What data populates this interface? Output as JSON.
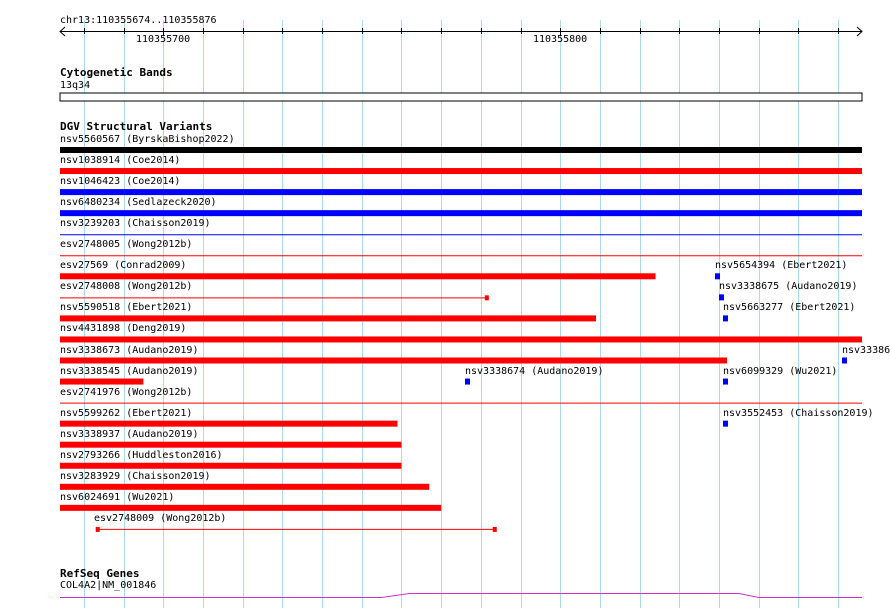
{
  "colors": {
    "grid": "#aadbee",
    "red": "#ff0000",
    "blue": "#0000ff",
    "black": "#000000",
    "refseq": "#cc33cc",
    "separator": "#cc0000"
  },
  "ruler": {
    "locus": "chr13:110355674..110355876",
    "ticks": [
      {
        "pos": 110355700,
        "label": "110355700"
      },
      {
        "pos": 110355800,
        "label": "110355800"
      }
    ]
  },
  "cytobands": {
    "title": "Cytogenetic Bands",
    "band": "13q34"
  },
  "dgv": {
    "title": "DGV Structural Variants",
    "rows": [
      {
        "label": "nsv5560567 (ByrskaBishop2022)",
        "features": [
          {
            "start": 110355674,
            "end": 110355876,
            "color": "black",
            "style": "bar"
          }
        ]
      },
      {
        "label": "nsv1038914 (Coe2014)",
        "features": [
          {
            "start": 110355674,
            "end": 110355876,
            "color": "red",
            "style": "bar"
          }
        ]
      },
      {
        "label": "nsv1046423 (Coe2014)",
        "features": [
          {
            "start": 110355674,
            "end": 110355876,
            "color": "blue",
            "style": "bar"
          }
        ]
      },
      {
        "label": "nsv6480234 (Sedlazeck2020)",
        "features": [
          {
            "start": 110355674,
            "end": 110355876,
            "color": "blue",
            "style": "bar"
          }
        ]
      },
      {
        "label": "nsv3239203 (Chaisson2019)",
        "features": [
          {
            "start": 110355674,
            "end": 110355876,
            "color": "blue",
            "style": "line"
          }
        ]
      },
      {
        "label": "esv2748005 (Wong2012b)",
        "features": [
          {
            "start": 110355674,
            "end": 110355876,
            "color": "red",
            "style": "line"
          }
        ]
      },
      {
        "label": "esv27569 (Conrad2009)",
        "features": [
          {
            "start": 110355674,
            "end": 110355824,
            "color": "red",
            "style": "bar"
          }
        ]
      },
      {
        "label": "nsv5654394 (Ebert2021)",
        "features": [
          {
            "start": 110355839,
            "end": 110355840,
            "color": "blue",
            "style": "dot"
          }
        ]
      },
      {
        "label": "esv2748008 (Wong2012b)",
        "features": [
          {
            "start": 110355674,
            "end": 110355782,
            "color": "red",
            "style": "line"
          }
        ]
      },
      {
        "label": "nsv3338675 (Audano2019)",
        "features": [
          {
            "start": 110355840,
            "end": 110355841,
            "color": "blue",
            "style": "dot"
          }
        ]
      },
      {
        "label": "nsv5590518 (Ebert2021)",
        "features": [
          {
            "start": 110355674,
            "end": 110355809,
            "color": "red",
            "style": "bar"
          }
        ]
      },
      {
        "label": "nsv5663277 (Ebert2021)",
        "features": [
          {
            "start": 110355841,
            "end": 110355842,
            "color": "blue",
            "style": "dot"
          }
        ]
      },
      {
        "label": "nsv4431898 (Deng2019)",
        "features": [
          {
            "start": 110355674,
            "end": 110355876,
            "color": "red",
            "style": "bar"
          }
        ]
      },
      {
        "label": "nsv3338673 (Audano2019)",
        "features": [
          {
            "start": 110355674,
            "end": 110355842,
            "color": "red",
            "style": "bar"
          }
        ]
      },
      {
        "label": "nsv33386",
        "features": [
          {
            "start": 110355871,
            "end": 110355872,
            "color": "blue",
            "style": "dot"
          }
        ]
      },
      {
        "label": "nsv3338545 (Audano2019)",
        "features": [
          {
            "start": 110355674,
            "end": 110355695,
            "color": "red",
            "style": "bar"
          }
        ]
      },
      {
        "label": "nsv3338674 (Audano2019)",
        "features": [
          {
            "start": 110355776,
            "end": 110355777,
            "color": "blue",
            "style": "dot"
          }
        ]
      },
      {
        "label": "nsv6099329 (Wu2021)",
        "features": [
          {
            "start": 110355841,
            "end": 110355842,
            "color": "blue",
            "style": "dot"
          }
        ]
      },
      {
        "label": "esv2741976 (Wong2012b)",
        "features": [
          {
            "start": 110355674,
            "end": 110355876,
            "color": "red",
            "style": "line"
          }
        ]
      },
      {
        "label": "nsv5599262 (Ebert2021)",
        "features": [
          {
            "start": 110355674,
            "end": 110355759,
            "color": "red",
            "style": "bar"
          }
        ]
      },
      {
        "label": "nsv3552453 (Chaisson2019)",
        "features": [
          {
            "start": 110355841,
            "end": 110355842,
            "color": "blue",
            "style": "dot"
          }
        ]
      },
      {
        "label": "nsv3338937 (Audano2019)",
        "features": [
          {
            "start": 110355674,
            "end": 110355760,
            "color": "red",
            "style": "bar"
          }
        ]
      },
      {
        "label": "nsv2793266 (Huddleston2016)",
        "features": [
          {
            "start": 110355674,
            "end": 110355760,
            "color": "red",
            "style": "bar"
          }
        ]
      },
      {
        "label": "nsv3283929 (Chaisson2019)",
        "features": [
          {
            "start": 110355674,
            "end": 110355767,
            "color": "red",
            "style": "bar"
          }
        ]
      },
      {
        "label": "nsv6024691 (Wu2021)",
        "features": [
          {
            "start": 110355674,
            "end": 110355770,
            "color": "red",
            "style": "bar"
          }
        ]
      },
      {
        "label": "esv2748009 (Wong2012b)",
        "features": [
          {
            "start": 110355683,
            "end": 110355784,
            "color": "red",
            "style": "line"
          }
        ]
      }
    ]
  },
  "refseq": {
    "title": "RefSeq Genes",
    "gene": "COL4A2|NM_001846"
  }
}
